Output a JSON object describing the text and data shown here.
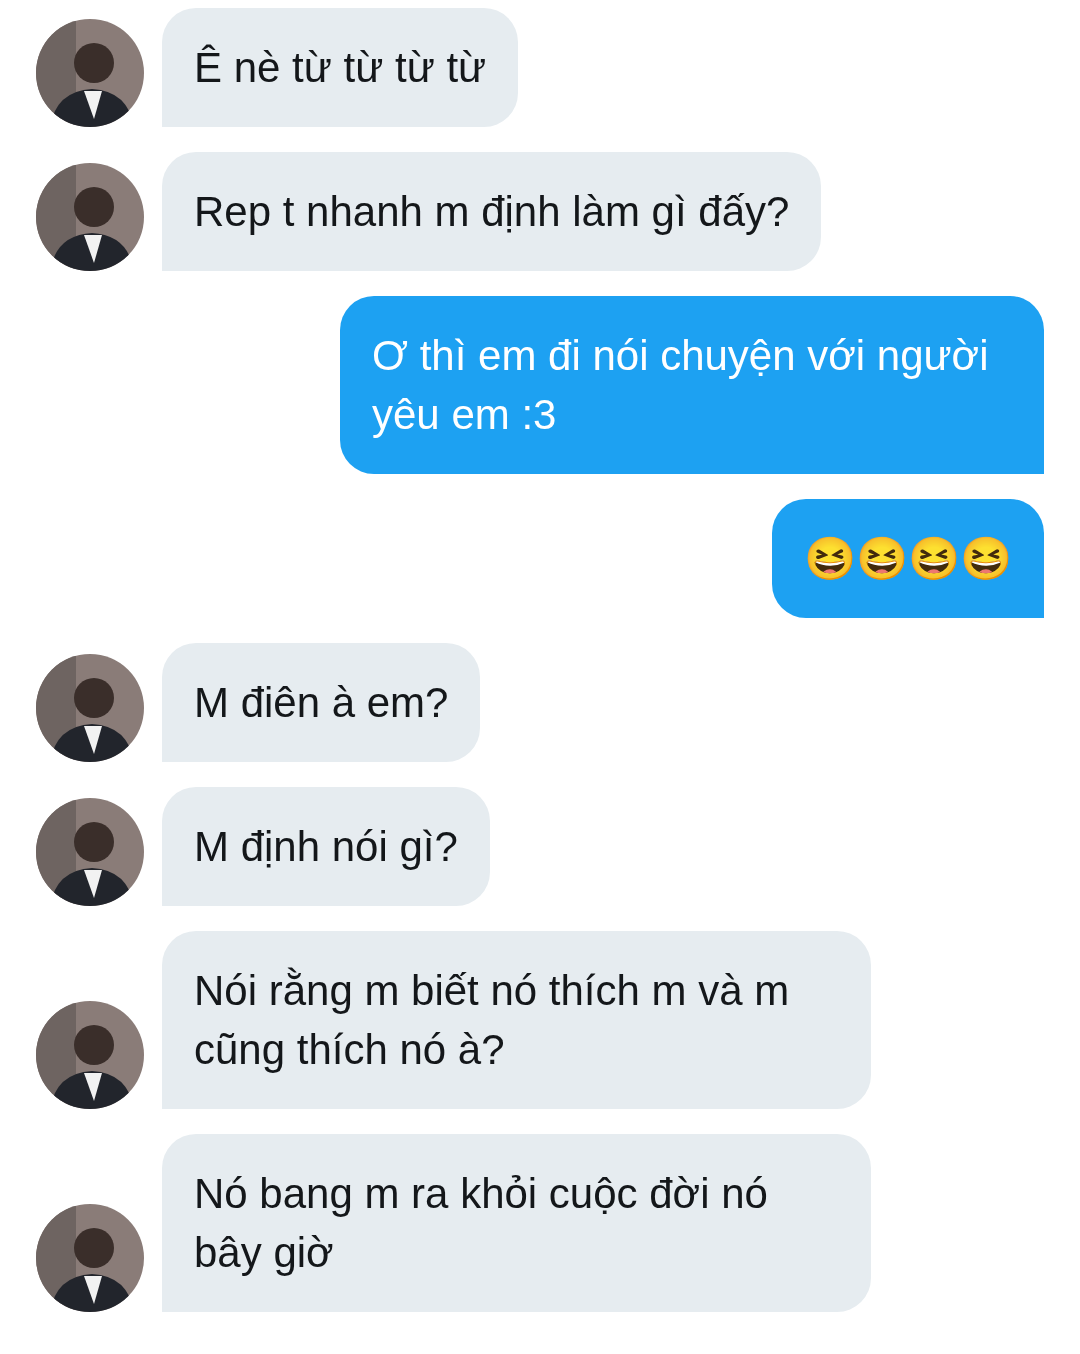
{
  "messages": [
    {
      "kind": "incoming",
      "text": "Ê nè từ từ từ từ"
    },
    {
      "kind": "incoming",
      "text": "Rep t nhanh m định làm gì đấy?"
    },
    {
      "kind": "outgoing",
      "text": "Ơ thì em đi nói chuyện với người yêu em :3"
    },
    {
      "kind": "outgoing",
      "text": "😆😆😆😆"
    },
    {
      "kind": "incoming",
      "text": "M điên à em?"
    },
    {
      "kind": "incoming",
      "text": "M định nói gì?"
    },
    {
      "kind": "incoming",
      "text": "Nói rằng m biết nó thích m và m cũng thích nó à?"
    },
    {
      "kind": "incoming",
      "text": "Nó bang m ra khỏi cuộc đời nó bây giờ"
    }
  ]
}
